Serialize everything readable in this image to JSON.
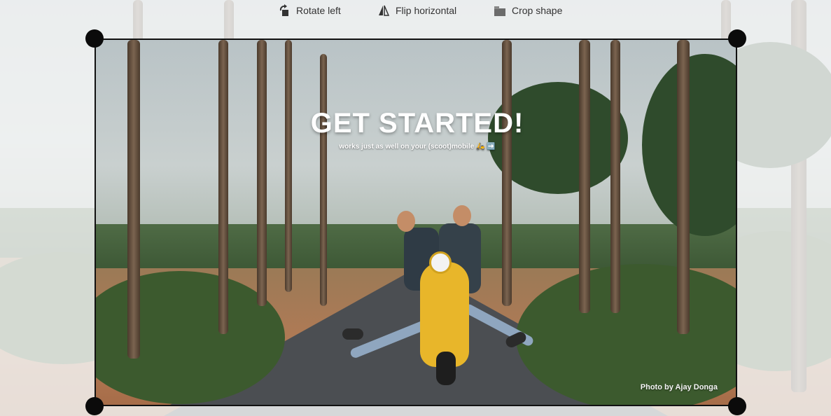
{
  "toolbar": {
    "rotate_left": {
      "label": "Rotate left",
      "icon": "rotate-left-icon"
    },
    "flip_horizontal": {
      "label": "Flip horizontal",
      "icon": "flip-horizontal-icon"
    },
    "crop_shape": {
      "label": "Crop shape",
      "icon": "crop-shape-icon"
    }
  },
  "photo": {
    "title": "GET STARTED!",
    "subtitle": "works just as well on your (scoot)mobile 🛵 ➡️",
    "credit": "Photo by Ajay Donga"
  },
  "colors": {
    "handle": "#0b0b0b",
    "crop_border": "#111111",
    "scooter": "#e8b62a"
  }
}
